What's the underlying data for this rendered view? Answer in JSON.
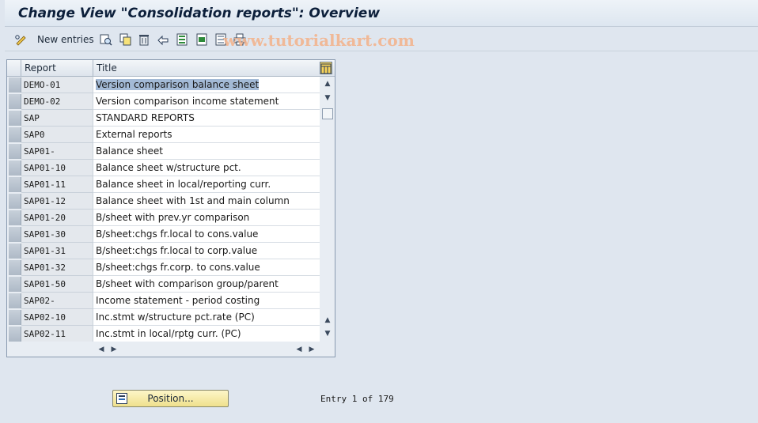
{
  "window": {
    "title": "Change View \"Consolidation reports\": Overview"
  },
  "toolbar": {
    "new_entries_label": "New entries",
    "watermark": "www.tutorialkart.com",
    "icons": [
      "pencil-glasses-icon",
      "details-icon",
      "copy-icon",
      "delete-icon",
      "undo-icon",
      "select-all-icon",
      "select-block-icon",
      "deselect-all-icon",
      "print-icon"
    ]
  },
  "table": {
    "columns": [
      "Report",
      "Title"
    ],
    "rows": [
      {
        "report": "DEMO-01",
        "title": "Version comparison balance sheet"
      },
      {
        "report": "DEMO-02",
        "title": "Version comparison income statement"
      },
      {
        "report": "SAP",
        "title": "STANDARD REPORTS"
      },
      {
        "report": "SAP0",
        "title": "External reports"
      },
      {
        "report": "SAP01-",
        "title": "Balance sheet"
      },
      {
        "report": "SAP01-10",
        "title": "Balance sheet w/structure pct."
      },
      {
        "report": "SAP01-11",
        "title": "Balance sheet in local/reporting curr."
      },
      {
        "report": "SAP01-12",
        "title": "Balance sheet with 1st and main column"
      },
      {
        "report": "SAP01-20",
        "title": "B/sheet with prev.yr comparison"
      },
      {
        "report": "SAP01-30",
        "title": "B/sheet:chgs fr.local to cons.value"
      },
      {
        "report": "SAP01-31",
        "title": "B/sheet:chgs fr.local to corp.value"
      },
      {
        "report": "SAP01-32",
        "title": "B/sheet:chgs fr.corp. to cons.value"
      },
      {
        "report": "SAP01-50",
        "title": "B/sheet with comparison group/parent"
      },
      {
        "report": "SAP02-",
        "title": "Income statement - period costing"
      },
      {
        "report": "SAP02-10",
        "title": "Inc.stmt w/structure pct.rate (PC)"
      },
      {
        "report": "SAP02-11",
        "title": "Inc.stmt in local/rptg curr. (PC)"
      }
    ],
    "selected_row_index": 0
  },
  "footer": {
    "position_button_label": "Position...",
    "entry_info": "Entry 1 of 179"
  },
  "colors": {
    "background": "#dfe6ef",
    "button_yellow": "#efe08c",
    "selection_highlight": "#a3bad6"
  }
}
